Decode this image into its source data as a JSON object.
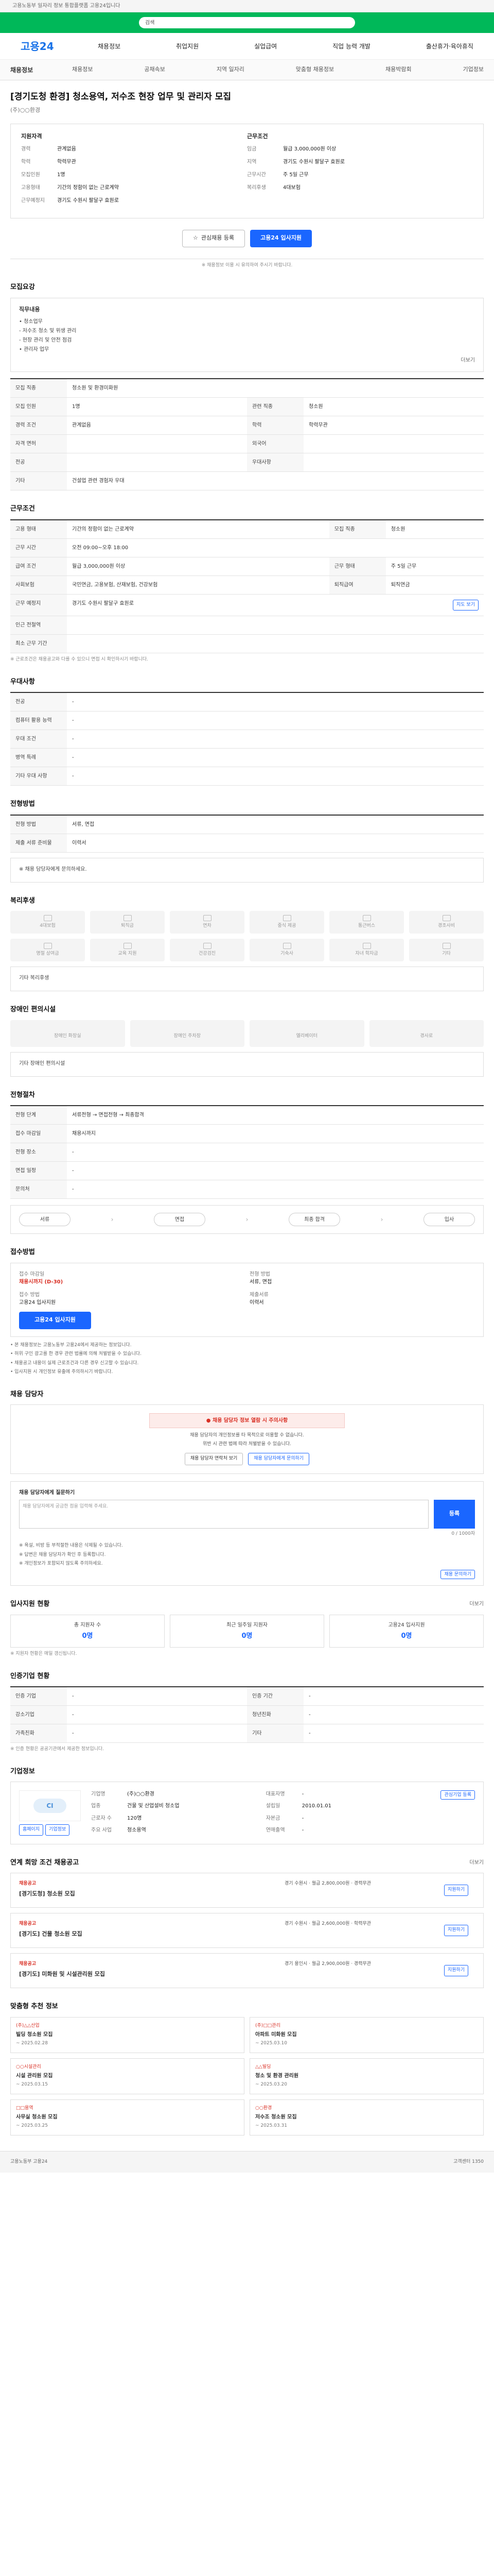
{
  "topbar": {
    "text": "고용노동부 일자리 정보 통합플랫폼 고용24입니다"
  },
  "banner": {
    "search": "검색"
  },
  "header": {
    "logo": "고용24",
    "menu": [
      "채용정보",
      "취업지원",
      "실업급여",
      "직업 능력 개발",
      "출산휴가·육아휴직"
    ]
  },
  "subnav": {
    "current": "채용정보",
    "items": [
      "채용정보",
      "공채속보",
      "지역 일자리",
      "맞춤형 채용정보",
      "채용박람회",
      "기업정보"
    ]
  },
  "job": {
    "title": "[경기도청 환경] 청소용역, 저수조 현장 업무 및 관리자 모집",
    "company": "(주)○○환경"
  },
  "summary": {
    "left_title": "지원자격",
    "left": [
      {
        "k": "경력",
        "v": "관계없음"
      },
      {
        "k": "학력",
        "v": "학력무관"
      },
      {
        "k": "모집인원",
        "v": "1명"
      },
      {
        "k": "고용형태",
        "v": "기간의 정함이 없는 근로계약"
      },
      {
        "k": "근무예정지",
        "v": "경기도 수원시 팔달구 효원로"
      }
    ],
    "right_title": "근무조건",
    "right": [
      {
        "k": "임금",
        "v": "월급 3,000,000원 이상"
      },
      {
        "k": "지역",
        "v": "경기도 수원시 팔달구 효원로"
      },
      {
        "k": "근무시간",
        "v": "주 5일 근무"
      },
      {
        "k": "복리후생",
        "v": "4대보험"
      }
    ]
  },
  "actions": {
    "scrap": "관심채용 등록",
    "apply": "고용24 입사지원"
  },
  "note_small": "※ 채용정보 이용 시 유의하여 주시기 바랍니다.",
  "sections": {
    "recruit": "모집요강",
    "work": "근무조건",
    "requirement": "우대사항",
    "docs": "전형방법",
    "welfare": "복리후생",
    "facility": "장애인 편의시설",
    "process": "전형절차",
    "apply": "접수방법",
    "request": "채용 담당자",
    "stats": "입사지원 현황",
    "manager": "인증기업 현황",
    "company": "기업정보",
    "similar": "연계 희망 조건 채용공고",
    "recommend": "맞춤형 추천 정보"
  },
  "recruit": {
    "heading": "직무내용",
    "lines": [
      "• 청소업무",
      "  - 저수조 청소 및 위생 관리",
      "  - 현장 관리 및 안전 점검",
      "• 관리자 업무"
    ],
    "more": "더보기",
    "rows": [
      {
        "k": "모집 직종",
        "v": "청소원 및 환경미화원"
      },
      {
        "k": "모집 인원",
        "v": "1명",
        "k2": "관련 직종",
        "v2": "청소원"
      },
      {
        "k": "경력 조건",
        "v": "관계없음",
        "k2": "학력",
        "v2": "학력무관"
      },
      {
        "k": "자격 면허",
        "v": "",
        "k2": "외국어",
        "v2": ""
      },
      {
        "k": "전공",
        "v": "",
        "k2": "우대사항",
        "v2": ""
      },
      {
        "k": "기타",
        "v": "건설업 관련 경험자 우대"
      }
    ]
  },
  "work": {
    "rows": [
      {
        "k": "고용 형태",
        "v": "기간의 정함이 없는 근로계약",
        "k2": "모집 직종",
        "v2": "청소원"
      },
      {
        "k": "근무 시간",
        "v": "오전 09:00~오후 18:00"
      },
      {
        "k": "급여 조건",
        "v": "월급 3,000,000원 이상",
        "k2": "근무 형태",
        "v2": "주 5일 근무"
      },
      {
        "k": "사회보험",
        "v": "국민연금, 고용보험, 산재보험, 건강보험",
        "k2": "퇴직급여",
        "v2": "퇴직연금"
      },
      {
        "k": "근무 예정지",
        "v": "경기도 수원시 팔달구 효원로"
      },
      {
        "k": "인근 전철역",
        "v": ""
      },
      {
        "k": "최소 근무 기간",
        "v": ""
      }
    ],
    "map_btn": "지도 보기",
    "warn": "※ 근로조건은 채용공고와 다를 수 있으니 면접 시 확인하시기 바랍니다."
  },
  "pref": {
    "rows": [
      {
        "k": "전공",
        "v": "-"
      },
      {
        "k": "컴퓨터 활용 능력",
        "v": "-"
      },
      {
        "k": "우대 조건",
        "v": "-"
      },
      {
        "k": "병역 특례",
        "v": "-"
      },
      {
        "k": "기타 우대 사항",
        "v": "-"
      }
    ]
  },
  "docs": {
    "rows": [
      {
        "k": "전형 방법",
        "v": "서류, 면접"
      },
      {
        "k": "제출 서류 준비물",
        "v": "이력서"
      }
    ],
    "note": "※ 채용 담당자에게 문의하세요."
  },
  "welfare": {
    "items": [
      "4대보험",
      "퇴직금",
      "연차",
      "중식 제공",
      "통근버스",
      "경조사비",
      "명절 상여금",
      "교육 지원",
      "건강검진",
      "기숙사",
      "자녀 학자금",
      "기타"
    ],
    "note": "기타 복리후생"
  },
  "facility": {
    "items": [
      "장애인 화장실",
      "장애인 주차장",
      "엘리베이터",
      "경사로"
    ],
    "note": "기타 장애인 편의시설"
  },
  "process": {
    "table": [
      {
        "k": "전형 단계",
        "v": "서류전형 → 면접전형 → 최종합격"
      },
      {
        "k": "접수 마감일",
        "v": "채용시까지"
      },
      {
        "k": "전형 장소",
        "v": "-"
      },
      {
        "k": "면접 일정",
        "v": "-"
      },
      {
        "k": "문의처",
        "v": "-"
      }
    ],
    "steps": [
      "서류",
      "면접",
      "최종 합격",
      "입사"
    ]
  },
  "apply": {
    "k1": "접수 마감일",
    "v1": "채용시까지 (D-30)",
    "k2": "전형 방법",
    "v2": "서류, 면접",
    "k3": "접수 방법",
    "v3": "고용24 입사지원",
    "k4": "제출서류",
    "v4": "이력서",
    "btn": "고용24 입사지원",
    "bullets": [
      "• 본 채용정보는 고용노동부 고용24에서 제공하는 정보입니다.",
      "• 허위 구인 광고를 한 경우 관련 법률에 의해 처벌받을 수 있습니다.",
      "• 채용공고 내용이 실제 근로조건과 다른 경우 신고할 수 있습니다.",
      "• 입사지원 시 개인정보 유출에 주의하시기 바랍니다."
    ]
  },
  "request": {
    "bar": "● 채용 담당자 정보 열람 시 주의사항",
    "lines": [
      "채용 담당자의 개인정보를 타 목적으로 이용할 수 없습니다.",
      "위반 시 관련 법에 따라 처벌받을 수 있습니다."
    ],
    "b1": "채용 담당자 연락처 보기",
    "b2": "채용 담당자에게 문의하기"
  },
  "inquiry": {
    "label": "채용 담당자에게 질문하기",
    "placeholder": "채용 담당자에게 궁금한 점을 입력해 주세요.",
    "btn": "등록",
    "note": "0 / 1000자",
    "notes": [
      "※ 욕설, 비방 등 부적절한 내용은 삭제될 수 있습니다.",
      "※ 답변은 채용 담당자가 확인 후 등록합니다.",
      "※ 개인정보가 포함되지 않도록 주의하세요."
    ],
    "link": "채용 문의하기"
  },
  "stats": {
    "more": "더보기",
    "items": [
      {
        "n": "총 지원자 수",
        "c": "0명"
      },
      {
        "n": "최근 일주일 지원자",
        "c": "0명"
      },
      {
        "n": "고용24 입사지원",
        "c": "0명"
      }
    ],
    "note": "※ 지원자 현황은 매일 갱신됩니다."
  },
  "cert": {
    "rows": [
      {
        "k": "인증 기업",
        "v": "-",
        "k2": "인증 기간",
        "v2": "-"
      },
      {
        "k": "강소기업",
        "v": "-",
        "k2": "청년친화",
        "v2": "-"
      },
      {
        "k": "가족친화",
        "v": "-",
        "k2": "기타",
        "v2": "-"
      }
    ],
    "warn": "※ 인증 현황은 공공기관에서 제공한 정보입니다."
  },
  "company": {
    "logo": "CI",
    "btns": [
      "홈페이지",
      "기업정보"
    ],
    "rows": [
      {
        "k": "기업명",
        "v": "(주)○○환경"
      },
      {
        "k": "대표자명",
        "v": "-"
      },
      {
        "k": "업종",
        "v": "건물 및 산업설비 청소업"
      },
      {
        "k": "설립일",
        "v": "2010.01.01"
      },
      {
        "k": "근로자 수",
        "v": "120명"
      },
      {
        "k": "자본금",
        "v": "-"
      },
      {
        "k": "주요 사업",
        "v": "청소용역"
      },
      {
        "k": "연매출액",
        "v": "-"
      }
    ],
    "follow": "관심기업 등록"
  },
  "similar": {
    "more": "더보기",
    "items": [
      {
        "co": "채용공고",
        "t": "[경기도청] 청소원 모집",
        "m": "경기 수원시 · 월급 2,800,000원 · 경력무관",
        "a": "지원하기"
      },
      {
        "co": "채용공고",
        "t": "[경기도] 건물 청소원 모집",
        "m": "경기 수원시 · 월급 2,600,000원 · 학력무관",
        "a": "지원하기"
      },
      {
        "co": "채용공고",
        "t": "[경기도] 미화원 및 시설관리원 모집",
        "m": "경기 용인시 · 월급 2,900,000원 · 경력무관",
        "a": "지원하기"
      }
    ]
  },
  "recommend": {
    "items": [
      {
        "co": "(주)△△산업",
        "t": "빌딩 청소원 모집",
        "d": "~ 2025.02.28"
      },
      {
        "co": "(주)□□관리",
        "t": "아파트 미화원 모집",
        "d": "~ 2025.03.10"
      },
      {
        "co": "○○시설관리",
        "t": "시설 관리원 모집",
        "d": "~ 2025.03.15"
      },
      {
        "co": "△△빌딩",
        "t": "청소 및 환경 관리원",
        "d": "~ 2025.03.20"
      },
      {
        "co": "□□용역",
        "t": "사무실 청소원 모집",
        "d": "~ 2025.03.25"
      },
      {
        "co": "○○환경",
        "t": "저수조 청소원 모집",
        "d": "~ 2025.03.31"
      }
    ]
  },
  "footer": {
    "left": "고용노동부 고용24",
    "right": "고객센터 1350"
  }
}
